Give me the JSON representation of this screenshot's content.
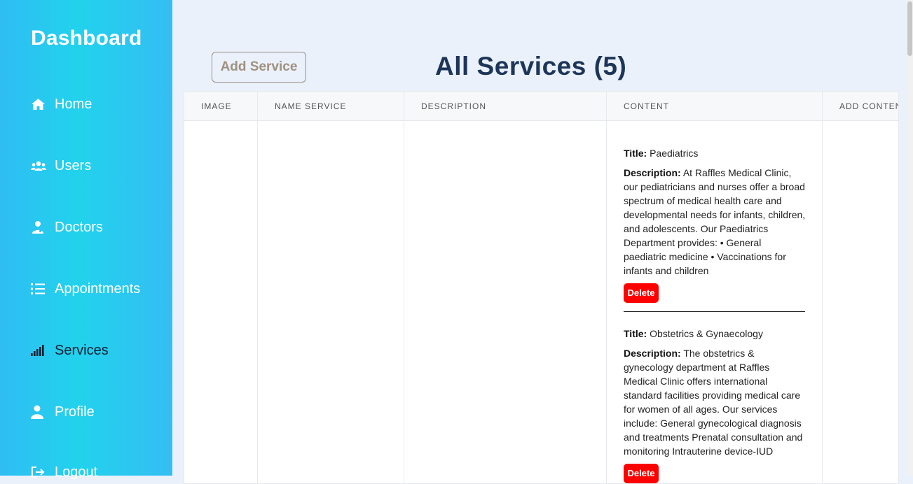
{
  "sidebar": {
    "brand": "Dashboard",
    "items": [
      {
        "label": "Home",
        "icon": "home-icon"
      },
      {
        "label": "Users",
        "icon": "users-icon"
      },
      {
        "label": "Doctors",
        "icon": "doctor-icon"
      },
      {
        "label": "Appointments",
        "icon": "list-icon"
      },
      {
        "label": "Services",
        "icon": "signal-icon",
        "active": true
      },
      {
        "label": "Profile",
        "icon": "user-icon"
      },
      {
        "label": "Logout",
        "icon": "logout-icon"
      }
    ]
  },
  "header": {
    "add_button": "Add Service",
    "title": "All Services (5)"
  },
  "table": {
    "columns": [
      "IMAGE",
      "NAME SERVICE",
      "DESCRIPTION",
      "CONTENT",
      "ADD CONTENT"
    ],
    "content": [
      {
        "title_label": "Title:",
        "title": "Paediatrics",
        "description_label": "Description:",
        "description": "At Raffles Medical Clinic, our pediatricians and nurses offer a broad spectrum of medical health care and developmental needs for infants, children, and adolescents. Our Paediatrics Department provides: • General paediatric medicine • Vaccinations for infants and children",
        "delete_label": "Delete"
      },
      {
        "title_label": "Title:",
        "title": "Obstetrics & Gynaecology",
        "description_label": "Description:",
        "description": "The obstetrics & gynecology department at Raffles Medical Clinic offers international standard facilities providing medical care for women of all ages. Our services include: General gynecological diagnosis and treatments Prenatal consultation and monitoring Intrauterine device-IUD",
        "delete_label": "Delete"
      }
    ]
  },
  "colors": {
    "sidebar_gradient_start": "#2fbdf3",
    "sidebar_gradient_mid": "#22d2ec",
    "page_bg": "#eaf1fb",
    "title": "#1d3557",
    "delete_button": "#ff0000",
    "add_button_text": "#a0917f"
  }
}
